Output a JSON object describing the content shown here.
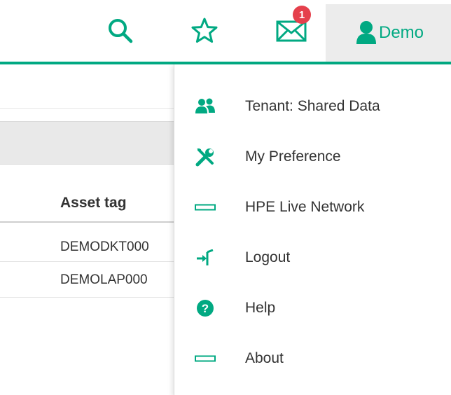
{
  "header": {
    "search_icon": "search-icon",
    "favorites_icon": "star-icon",
    "messages_icon": "mail-icon",
    "messages_badge": "1",
    "user_icon": "user-icon",
    "user_label": "Demo"
  },
  "table": {
    "column_header": "Asset tag",
    "rows": [
      "DEMODKT000",
      "DEMOLAP000"
    ]
  },
  "user_menu": {
    "items": [
      {
        "label": "Tenant: Shared Data",
        "icon": "users-icon"
      },
      {
        "label": "My Preference",
        "icon": "wrench-screwdriver-icon"
      },
      {
        "label": "HPE Live Network",
        "icon": "network-bar-icon"
      },
      {
        "label": "Logout",
        "icon": "logout-icon"
      },
      {
        "label": "Help",
        "icon": "help-icon"
      },
      {
        "label": "About",
        "icon": "about-bar-icon"
      }
    ]
  },
  "colors": {
    "accent": "#01a982",
    "badge": "#e5404c",
    "text": "#333333",
    "user_button_bg": "#ececec"
  }
}
